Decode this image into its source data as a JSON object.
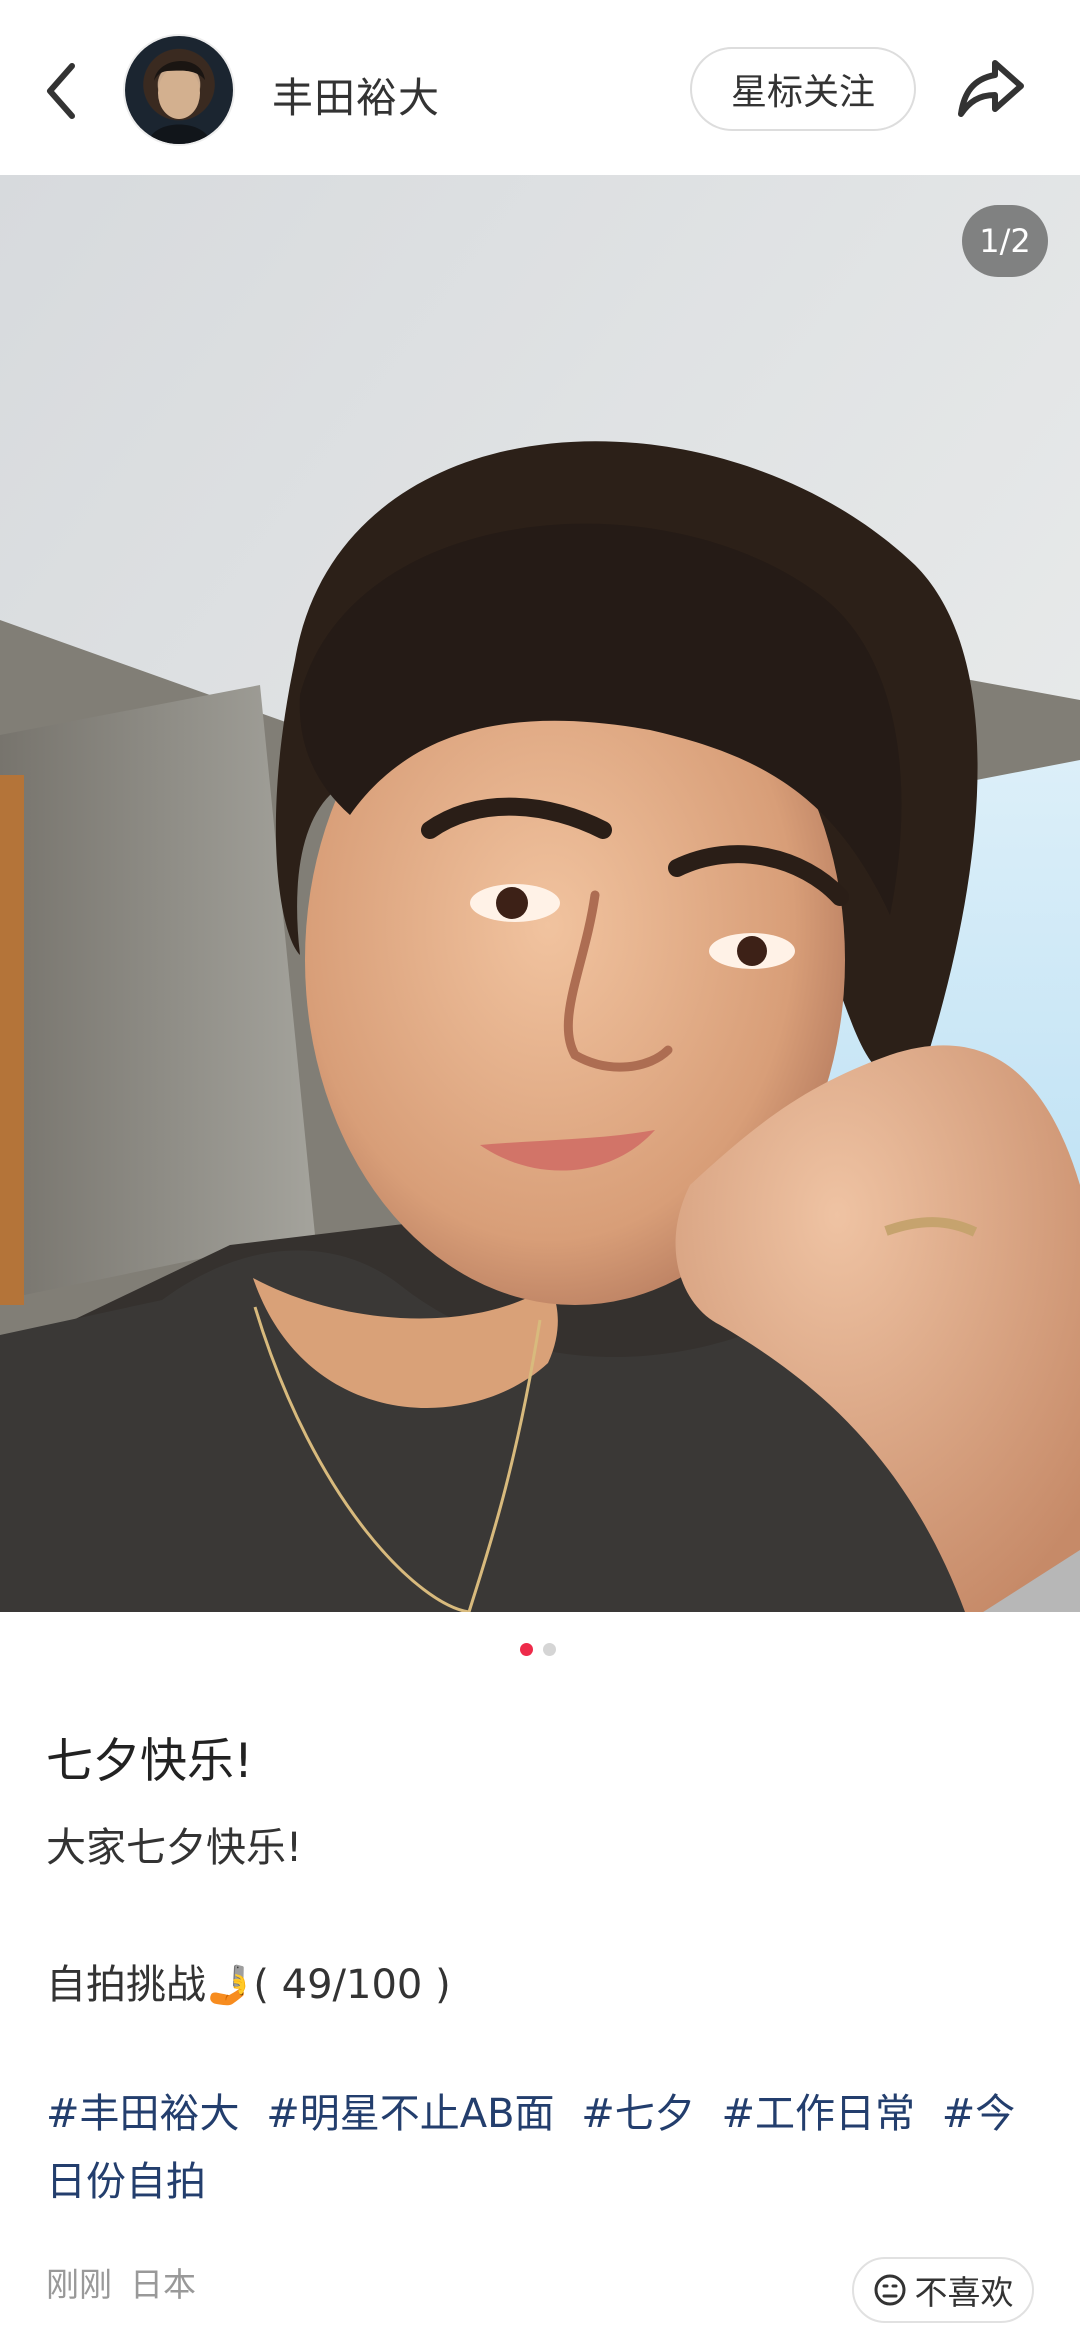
{
  "header": {
    "author_name": "丰田裕大",
    "follow_label": "星标关注"
  },
  "media": {
    "page_indicator": "1/2",
    "current_page": 1,
    "total_pages": 2
  },
  "post": {
    "title": "七夕快乐!",
    "body_line1": "大家七夕快乐!",
    "body_line2_text": "自拍挑战",
    "body_line2_emoji": "🤳",
    "body_line2_progress": "( 49/100 )",
    "tags": [
      "#丰田裕大",
      "#明星不止AB面",
      "#七夕",
      "#工作日常",
      "#今日份自拍"
    ]
  },
  "meta": {
    "time": "刚刚",
    "location": "日本",
    "dislike_label": "不喜欢"
  },
  "colors": {
    "accent": "#ee2b4a",
    "tag": "#233e6d",
    "meta": "#999999"
  },
  "icons": [
    "back-arrow-icon",
    "share-icon",
    "dislike-face-icon"
  ]
}
